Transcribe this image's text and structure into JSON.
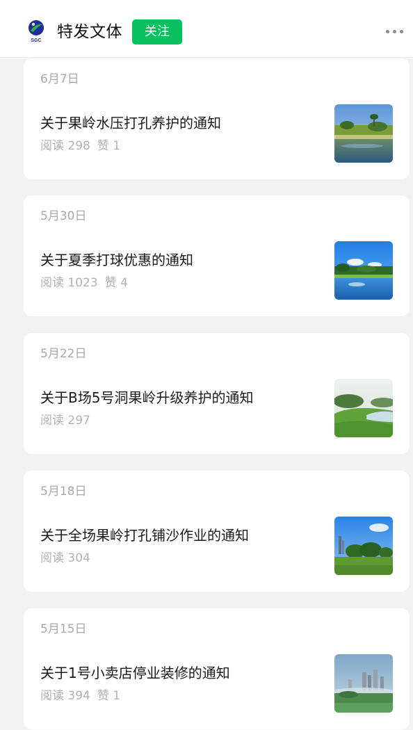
{
  "header": {
    "logo_text": "SGC",
    "account_name": "特发文体",
    "follow_label": "关注",
    "more_icon": "more-dots-icon"
  },
  "colors": {
    "follow_green": "#07c160",
    "page_background": "#f2f2f2",
    "meta_gray": "#a9a9a9"
  },
  "articles": [
    {
      "date": "6月7日",
      "title": "关于果岭水压打孔养护的通知",
      "reads": "阅读 298",
      "likes": "赞 1",
      "thumbnail": "golf-pond-photo"
    },
    {
      "date": "5月30日",
      "title": "关于夏季打球优惠的通知",
      "reads": "阅读 1023",
      "likes": "赞 4",
      "thumbnail": "golf-lake-sky-photo"
    },
    {
      "date": "5月22日",
      "title": "关于B场5号洞果岭升级养护的通知",
      "reads": "阅读 297",
      "likes": "",
      "thumbnail": "golf-hillside-lake-photo"
    },
    {
      "date": "5月18日",
      "title": "关于全场果岭打孔铺沙作业的通知",
      "reads": "阅读 304",
      "likes": "",
      "thumbnail": "golf-city-skyline-photo"
    },
    {
      "date": "5月15日",
      "title": "关于1号小卖店停业装修的通知",
      "reads": "阅读 394",
      "likes": "赞 1",
      "thumbnail": "golf-misty-city-photo"
    }
  ]
}
